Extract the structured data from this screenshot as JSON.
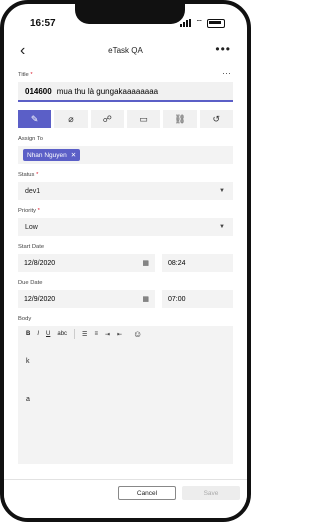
{
  "status_bar": {
    "time": "16:57"
  },
  "nav": {
    "title": "eTask QA",
    "back_icon": "chevron-left-icon",
    "more_icon": "ellipsis-icon"
  },
  "form": {
    "title_label": "Title",
    "title_id": "014600",
    "title_text": "mua thu là gungakaaaaaaaa",
    "tabs": [
      {
        "icon": "edit-icon",
        "active": true
      },
      {
        "icon": "attachment-icon"
      },
      {
        "icon": "chat-icon"
      },
      {
        "icon": "comment-icon"
      },
      {
        "icon": "link-icon"
      },
      {
        "icon": "history-icon"
      }
    ],
    "assign_label": "Assign To",
    "assignee": "Nhan Nguyen",
    "status_label": "Status",
    "status_value": "dev1",
    "priority_label": "Priority",
    "priority_value": "Low",
    "start_label": "Start Date",
    "start_date": "12/8/2020",
    "start_time": "08:24",
    "due_label": "Due Date",
    "due_date": "12/9/2020",
    "due_time": "07:00",
    "body_label": "Body",
    "toolbar": {
      "bold": "B",
      "italic": "I",
      "underline": "U",
      "strike": "abc"
    },
    "body_lines": [
      "k",
      "a"
    ]
  },
  "footer": {
    "cancel": "Cancel",
    "save": "Save"
  }
}
